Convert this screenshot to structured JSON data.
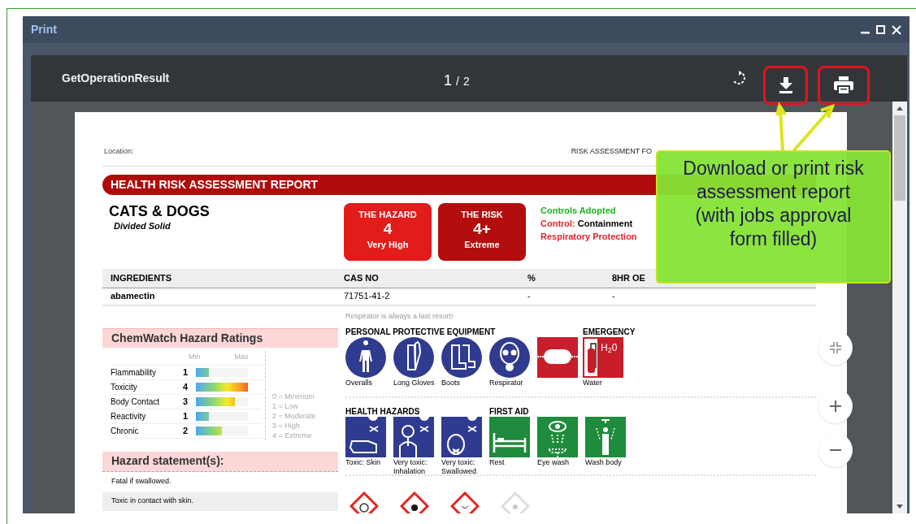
{
  "window": {
    "title": "Print"
  },
  "viewer": {
    "title": "GetOperationResult",
    "page": "1",
    "page_separator": "/",
    "page_total": "2",
    "buttons": [
      {
        "kind": "download",
        "highlighted": true
      },
      {
        "kind": "print",
        "highlighted": true
      }
    ]
  },
  "report": {
    "location_label": "Location:",
    "risk_for": "RISK ASSESSMENT FO",
    "banner": "HEALTH RISK ASSESSMENT REPORT",
    "product": "CATS & DOGS",
    "form": "Divided Solid",
    "badges": [
      {
        "title": "THE HAZARD",
        "value": "4",
        "rating": "Very High",
        "color": "#e21b1b"
      },
      {
        "title": "THE RISK",
        "value": "4+",
        "rating": "Extreme",
        "color": "#b30d0d"
      }
    ],
    "controls": {
      "heading": "Controls Adopted",
      "lines": [
        {
          "label": "Control:",
          "value": "Containment"
        },
        {
          "label": "Respiratory Protection"
        }
      ]
    },
    "table": {
      "columns": [
        "INGREDIENTS",
        "CAS NO",
        "%",
        "8HR OE"
      ],
      "rows": [
        [
          "abamectin",
          "71751-41-2",
          "-",
          "-"
        ]
      ]
    },
    "ratings": {
      "title": "ChemWatch Hazard Ratings",
      "min": "Min",
      "max": "Max",
      "items": [
        {
          "name": "Flammability",
          "value": "1",
          "level": 0.25
        },
        {
          "name": "Toxicity",
          "value": "4",
          "level": 1
        },
        {
          "name": "Body Contact",
          "value": "3",
          "level": 0.75
        },
        {
          "name": "Reactivity",
          "value": "1",
          "level": 0.25
        },
        {
          "name": "Chronic",
          "value": "2",
          "level": 0.5
        }
      ],
      "legend": [
        "0 = Minimum",
        "1 = Low",
        "2 = Moderate",
        "3 = High",
        "4 = Extreme"
      ]
    },
    "hazard_statements": {
      "title": "Hazard statement(s):",
      "items": [
        "Fatal if swallowed.",
        "Toxic in contact with skin."
      ]
    },
    "respirator_note": "Respirator is always a last resort!",
    "ppe": {
      "title": "PERSONAL PROTECTIVE EQUIPMENT",
      "items": [
        {
          "kind": "overalls",
          "label": "Overalls"
        },
        {
          "kind": "gloves",
          "label": "Long Gloves"
        },
        {
          "kind": "boots",
          "label": "Boots"
        },
        {
          "kind": "respirator",
          "label": "Respirator"
        },
        {
          "kind": "tank"
        }
      ]
    },
    "emergency": {
      "title": "EMERGENCY",
      "items": [
        {
          "kind": "extinguisher",
          "sign_text": "H$_{2}$0",
          "label": "Water"
        }
      ]
    },
    "health_hazards": {
      "title": "HEALTH HAZARDS",
      "items": [
        {
          "kind": "skin",
          "label": "Toxic: Skin"
        },
        {
          "kind": "inhalation",
          "label": "Very toxic: Inhalation"
        },
        {
          "kind": "swallowed",
          "label": "Very toxic: Swallowed"
        }
      ]
    },
    "first_aid": {
      "title": "FIRST AID",
      "items": [
        {
          "kind": "rest",
          "label": "Rest"
        },
        {
          "kind": "eyewash",
          "label": "Eye wash"
        },
        {
          "kind": "washbody",
          "label": "Wash body"
        }
      ]
    },
    "ghs": [
      {
        "kind": "oxidizer"
      },
      {
        "kind": "corrosive"
      },
      {
        "kind": "environment"
      },
      {
        "kind": "toxic"
      }
    ]
  },
  "callout": "Download or print risk assessment report (with jobs approval form filled)"
}
